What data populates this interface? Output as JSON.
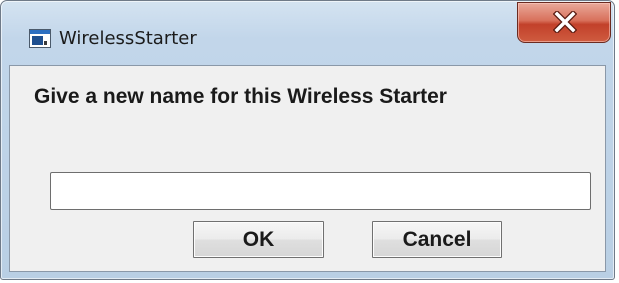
{
  "window": {
    "title": "WirelessStarter"
  },
  "dialog": {
    "prompt": "Give a new name for this Wireless Starter",
    "input": {
      "value": "",
      "placeholder": ""
    },
    "ok_label": "OK",
    "cancel_label": "Cancel"
  },
  "icons": {
    "app": "app-window-icon",
    "close": "close-icon"
  },
  "colors": {
    "titlebar": "#c2d6ea",
    "close_button": "#c2402a",
    "client_background": "#f0f0f0"
  }
}
